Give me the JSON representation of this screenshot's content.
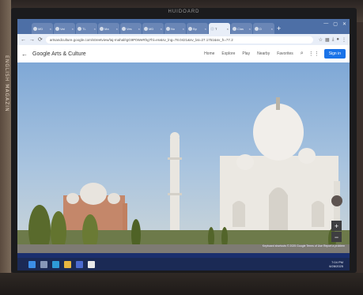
{
  "photo": {
    "monitor_brand": "HUIDOARD",
    "wall_sign_text": "ENGLISH MAGAZIN"
  },
  "browser": {
    "tabs": [
      {
        "label": "MD",
        "icon": "gmail-icon"
      },
      {
        "label": "Vat",
        "icon": "globe-icon"
      },
      {
        "label": "TL",
        "icon": "tab-icon"
      },
      {
        "label": "Ma",
        "icon": "google-icon"
      },
      {
        "label": "Ves",
        "icon": "globe-icon"
      },
      {
        "label": "MD",
        "icon": "google-icon"
      },
      {
        "label": "No",
        "icon": "globe-icon"
      },
      {
        "label": "Bp",
        "icon": "globe-icon"
      },
      {
        "label": "T",
        "icon": "arts-culture-icon",
        "active": true
      },
      {
        "label": "Clas",
        "icon": "video-icon"
      },
      {
        "label": "D",
        "icon": "globe-icon"
      }
    ],
    "new_tab": "+",
    "url": "artsandculture.google.com/streetview/taj-mahal/IgG9P0WeRhg?hl=en&sv_lng=78.0421&sv_lat=27.1751&sv_h=77.2"
  },
  "app": {
    "back_arrow": "←",
    "logo": "Google Arts & Culture",
    "nav": [
      "Home",
      "Explore",
      "Play",
      "Nearby",
      "Favorites"
    ],
    "sign_in": "Sign in"
  },
  "hero": {
    "subject": "Taj Mahal",
    "map_credit": "Keyboard shortcuts  © 2025 Google  Terms of Use  Report a problem"
  },
  "taskbar": {
    "time": "7:04 PM",
    "date": "6/28/2025"
  }
}
